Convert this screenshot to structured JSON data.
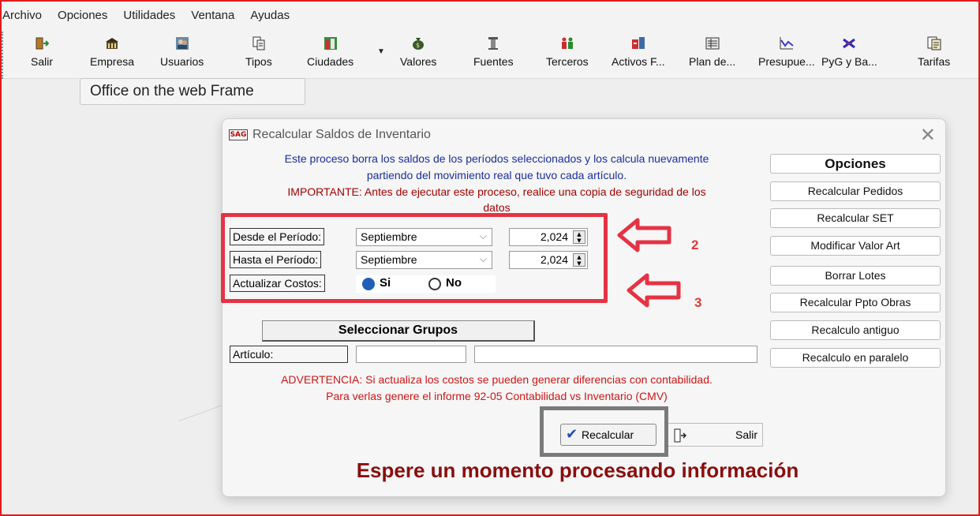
{
  "menu": [
    "Archivo",
    "Opciones",
    "Utilidades",
    "Ventana",
    "Ayudas"
  ],
  "toolbar": [
    {
      "label": "Salir",
      "icon": "exit-door-icon"
    },
    {
      "label": "Empresa",
      "icon": "building-icon"
    },
    {
      "label": "Usuarios",
      "icon": "users-icon"
    },
    {
      "label": "Tipos",
      "icon": "documents-icon"
    },
    {
      "label": "Ciudades",
      "icon": "city-icon"
    },
    {
      "label": "Valores",
      "icon": "money-bag-icon"
    },
    {
      "label": "Fuentes",
      "icon": "tower-icon"
    },
    {
      "label": "Terceros",
      "icon": "people-icon"
    },
    {
      "label": "Activos F...",
      "icon": "assets-icon"
    },
    {
      "label": "Plan de...",
      "icon": "ledger-icon"
    },
    {
      "label": "Presupue...",
      "icon": "chart-icon"
    },
    {
      "label": "PyG y Ba...",
      "icon": "balance-icon"
    },
    {
      "label": "Tarifas",
      "icon": "tariff-icon"
    }
  ],
  "tooltip": "Office on the web Frame",
  "dialog": {
    "title": "Recalcular Saldos de Inventario",
    "info_line1": "Este proceso borra los saldos de los períodos seleccionados y los calcula nuevamente",
    "info_line2": "partiendo del movimiento real que tuvo cada artículo.",
    "important_line1": "IMPORTANTE: Antes de ejecutar este proceso, realice una copia de seguridad de los",
    "important_line2": "datos",
    "desde_label": "Desde el Período:",
    "desde_month": "Septiembre",
    "desde_year": "2,024",
    "hasta_label": "Hasta el Período:",
    "hasta_month": "Septiembre",
    "hasta_year": "2,024",
    "costos_label": "Actualizar Costos:",
    "radio_si": "Si",
    "radio_no": "No",
    "seleccionar_grupos": "Seleccionar Grupos",
    "articulo_label": "Artículo:",
    "warning_line1": "ADVERTENCIA: Si actualiza los costos se pueden generar diferencias con contabilidad.",
    "warning_line2": "Para verlas genere el informe 92-05 Contabilidad vs Inventario (CMV)",
    "recalcular_btn": "Recalcular",
    "salir_btn": "Salir",
    "wait_msg": "Espere un momento procesando información",
    "options_header": "Opciones",
    "options": [
      "Recalcular Pedidos",
      "Recalcular SET",
      "Modificar Valor Art",
      "Borrar Lotes",
      "Recalcular Ppto Obras",
      "Recalculo antiguo",
      "Recalculo en paralelo"
    ]
  },
  "annotations": {
    "first": "2",
    "second": "3"
  },
  "colors": {
    "annotation_red": "#e53344",
    "info_blue": "#1a2d9e",
    "warning_red": "#cc1616",
    "wait_dark_red": "#a40000"
  }
}
